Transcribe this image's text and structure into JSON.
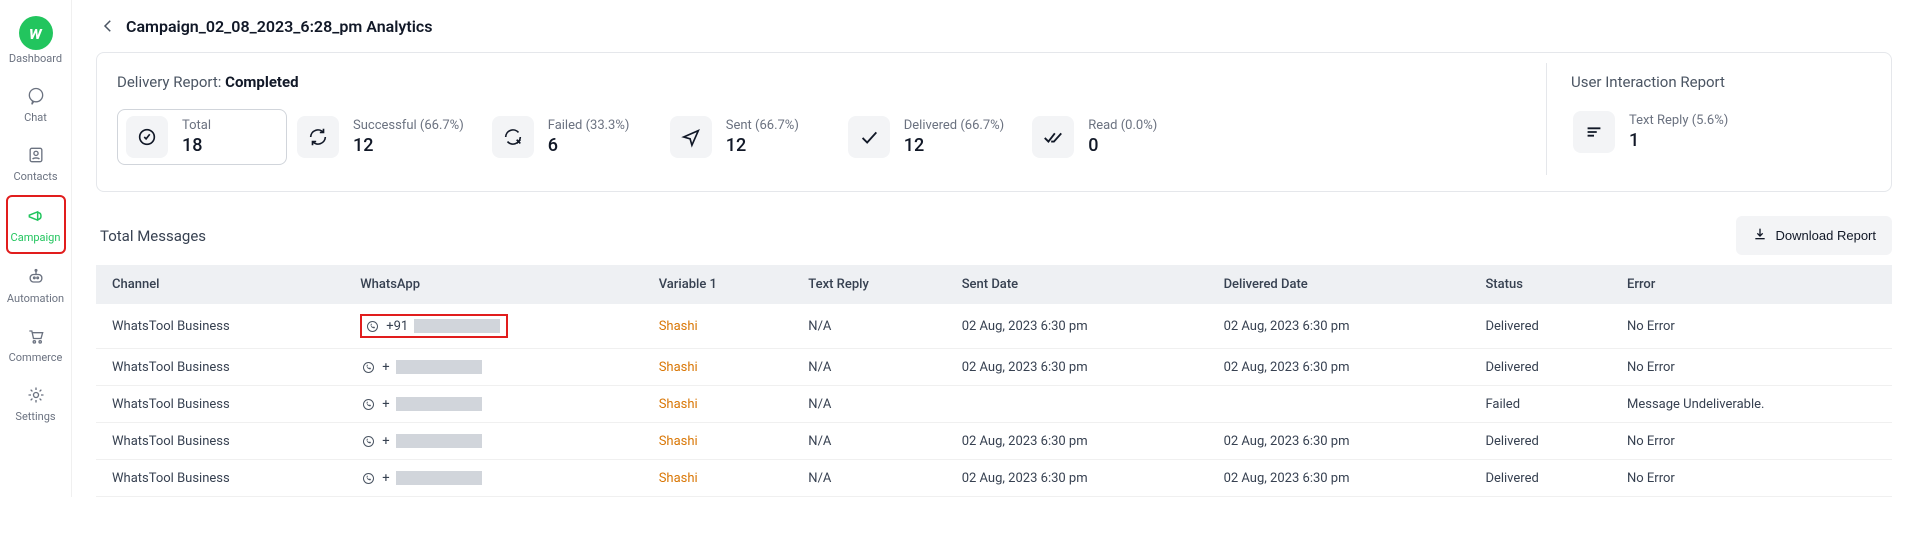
{
  "sidebar": {
    "items": [
      {
        "label": "Dashboard"
      },
      {
        "label": "Chat"
      },
      {
        "label": "Contacts"
      },
      {
        "label": "Campaign"
      },
      {
        "label": "Automation"
      },
      {
        "label": "Commerce"
      },
      {
        "label": "Settings"
      }
    ]
  },
  "header": {
    "title": "Campaign_02_08_2023_6:28_pm Analytics"
  },
  "delivery": {
    "heading_prefix": "Delivery Report: ",
    "heading_status": "Completed",
    "stats": {
      "total": {
        "label": "Total",
        "value": "18"
      },
      "successful": {
        "label": "Successful",
        "pct": "(66.7%)",
        "value": "12"
      },
      "failed": {
        "label": "Failed",
        "pct": "(33.3%)",
        "value": "6"
      },
      "sent": {
        "label": "Sent",
        "pct": "(66.7%)",
        "value": "12"
      },
      "delivered": {
        "label": "Delivered",
        "pct": "(66.7%)",
        "value": "12"
      },
      "read": {
        "label": "Read",
        "pct": "(0.0%)",
        "value": "0"
      }
    }
  },
  "uir": {
    "heading": "User Interaction Report",
    "text_reply": {
      "label": "Text Reply",
      "pct": "(5.6%)",
      "value": "1"
    }
  },
  "messages": {
    "heading": "Total Messages",
    "download_label": "Download Report",
    "columns": {
      "channel": "Channel",
      "whatsapp": "WhatsApp",
      "variable1": "Variable 1",
      "text_reply": "Text Reply",
      "sent_date": "Sent Date",
      "delivered_date": "Delivered Date",
      "status": "Status",
      "error": "Error"
    },
    "rows": [
      {
        "channel": "WhatsTool Business",
        "phone_prefix": "+91",
        "variable1": "Shashi",
        "text_reply": "N/A",
        "sent": "02 Aug, 2023 6:30 pm",
        "delivered": "02 Aug, 2023 6:30 pm",
        "status": "Delivered",
        "error": "No Error",
        "highlight": true
      },
      {
        "channel": "WhatsTool Business",
        "phone_prefix": "+",
        "variable1": "Shashi",
        "text_reply": "N/A",
        "sent": "02 Aug, 2023 6:30 pm",
        "delivered": "02 Aug, 2023 6:30 pm",
        "status": "Delivered",
        "error": "No Error"
      },
      {
        "channel": "WhatsTool Business",
        "phone_prefix": "+",
        "variable1": "Shashi",
        "text_reply": "N/A",
        "sent": "",
        "delivered": "",
        "status": "Failed",
        "error": "Message Undeliverable."
      },
      {
        "channel": "WhatsTool Business",
        "phone_prefix": "+",
        "variable1": "Shashi",
        "text_reply": "N/A",
        "sent": "02 Aug, 2023 6:30 pm",
        "delivered": "02 Aug, 2023 6:30 pm",
        "status": "Delivered",
        "error": "No Error"
      },
      {
        "channel": "WhatsTool Business",
        "phone_prefix": "+",
        "variable1": "Shashi",
        "text_reply": "N/A",
        "sent": "02 Aug, 2023 6:30 pm",
        "delivered": "02 Aug, 2023 6:30 pm",
        "status": "Delivered",
        "error": "No Error"
      }
    ]
  }
}
